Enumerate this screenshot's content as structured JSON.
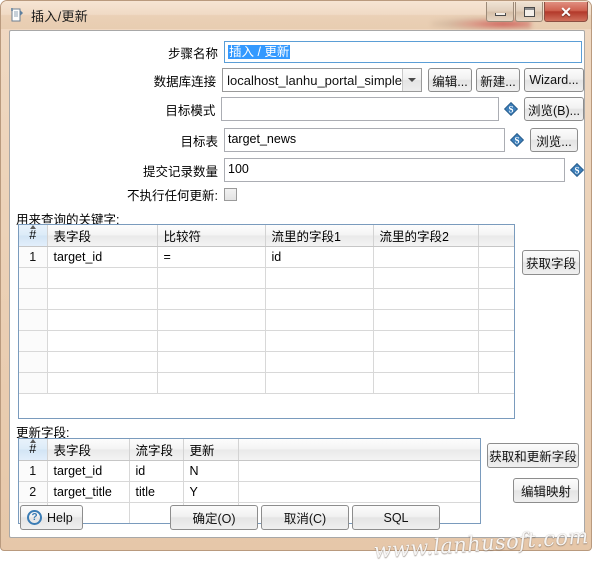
{
  "window": {
    "title": "插入/更新",
    "icon": "insert-update-step-icon",
    "controls": {
      "minimize": "minimize-icon",
      "maximize": "maximize-icon",
      "close": "✕"
    }
  },
  "form": {
    "step_name": {
      "label": "步骤名称",
      "value": "插入 / 更新",
      "selected": true
    },
    "connection": {
      "label": "数据库连接",
      "value": "localhost_lanhu_portal_simple",
      "buttons": [
        "编辑...",
        "新建...",
        "Wizard..."
      ]
    },
    "target_schema": {
      "label": "目标模式",
      "value": "",
      "placeholder": "",
      "browse_label": "浏览(B)...",
      "browse_underline": "B"
    },
    "target_table": {
      "label": "目标表",
      "value": "target_news",
      "browse_label": "浏览..."
    },
    "commit_size": {
      "label": "提交记录数量",
      "value": "100"
    },
    "no_update": {
      "label": "不执行任何更新:",
      "checked": false
    }
  },
  "lookup_section": {
    "title": "用来查询的关键字:",
    "get_fields_button": "获取字段",
    "columns": [
      "#",
      "表字段",
      "比较符",
      "流里的字段1",
      "流里的字段2",
      ""
    ],
    "rows": [
      {
        "idx": "1",
        "table_field": "target_id",
        "comparator": "=",
        "stream_field1": "id",
        "stream_field2": "",
        "extra": ""
      },
      {
        "idx": "",
        "table_field": "",
        "comparator": "",
        "stream_field1": "",
        "stream_field2": "",
        "extra": ""
      },
      {
        "idx": "",
        "table_field": "",
        "comparator": "",
        "stream_field1": "",
        "stream_field2": "",
        "extra": ""
      },
      {
        "idx": "",
        "table_field": "",
        "comparator": "",
        "stream_field1": "",
        "stream_field2": "",
        "extra": ""
      },
      {
        "idx": "",
        "table_field": "",
        "comparator": "",
        "stream_field1": "",
        "stream_field2": "",
        "extra": ""
      },
      {
        "idx": "",
        "table_field": "",
        "comparator": "",
        "stream_field1": "",
        "stream_field2": "",
        "extra": ""
      },
      {
        "idx": "",
        "table_field": "",
        "comparator": "",
        "stream_field1": "",
        "stream_field2": "",
        "extra": ""
      }
    ]
  },
  "update_section": {
    "title": "更新字段:",
    "get_update_fields_button": "获取和更新字段",
    "edit_mapping_button": "编辑映射",
    "columns": [
      "#",
      "表字段",
      "流字段",
      "更新",
      ""
    ],
    "rows": [
      {
        "idx": "1",
        "table_field": "target_id",
        "stream_field": "id",
        "update": "N",
        "extra": ""
      },
      {
        "idx": "2",
        "table_field": "target_title",
        "stream_field": "title",
        "update": "Y",
        "extra": ""
      },
      {
        "idx": "",
        "table_field": "",
        "stream_field": "",
        "update": "",
        "extra": ""
      }
    ]
  },
  "footer": {
    "help": "Help",
    "ok": "确定(O)",
    "ok_underline": "O",
    "cancel": "取消(C)",
    "cancel_underline": "C",
    "sql": "SQL",
    "sql_underline": "S"
  },
  "watermark": "www.lanhusoft.com",
  "colors": {
    "frame": "#e9cfb4",
    "close_button": "#b3392a",
    "selection": "#3399ff",
    "grid_border": "#7a9bbd",
    "variable_icon": "#2f6aa8"
  }
}
